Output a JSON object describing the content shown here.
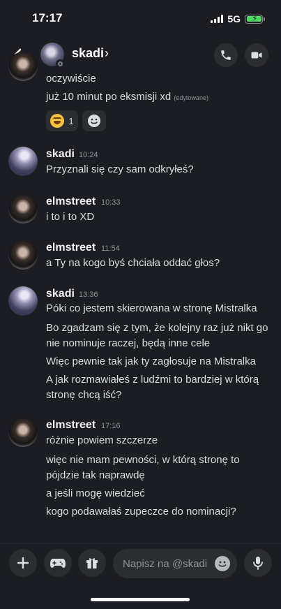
{
  "status_bar": {
    "time": "17:17",
    "network": "5G"
  },
  "header": {
    "name": "skadi",
    "chevron": "›"
  },
  "messages": [
    {
      "lines": [
        "oczywiście",
        "już 10 minut po eksmisji xd"
      ],
      "edited": "(edytowane)",
      "reaction": {
        "emoji": "laughing-emoji",
        "count": "1"
      }
    },
    {
      "author": "skadi",
      "time": "10:24",
      "lines": [
        "Przyznali się czy sam odkryłeś?"
      ]
    },
    {
      "author": "elmstreet",
      "time": "10:33",
      "lines": [
        "i to i to XD"
      ]
    },
    {
      "author": "elmstreet",
      "time": "11:54",
      "lines": [
        "a Ty na kogo byś chciała oddać głos?"
      ]
    },
    {
      "author": "skadi",
      "time": "13:36",
      "lines": [
        "Póki co jestem skierowana w stronę Mistralka",
        "Bo zgadzam się z tym, że kolejny raz już nikt go",
        "nie nominuje raczej, będą inne cele",
        "Więc pewnie tak jak ty zagłosuje na Mistralka",
        "A jak rozmawiałeś z ludźmi to bardziej w którą",
        "stronę chcą iść?"
      ]
    },
    {
      "author": "elmstreet",
      "time": "17:16",
      "lines": [
        "różnie powiem szczerze",
        "więc nie mam pewności, w którą stronę to",
        "pójdzie tak naprawdę",
        "a jeśli mogę wiedzieć",
        "kogo podawałaś zupeczce do nominacji?"
      ]
    }
  ],
  "composer": {
    "placeholder": "Napisz na @skadi"
  },
  "colors": {
    "background": "#1c1d22",
    "surface": "#2b2d31",
    "text": "#dbdee1",
    "muted": "#8e9297",
    "battery": "#4cd964"
  }
}
